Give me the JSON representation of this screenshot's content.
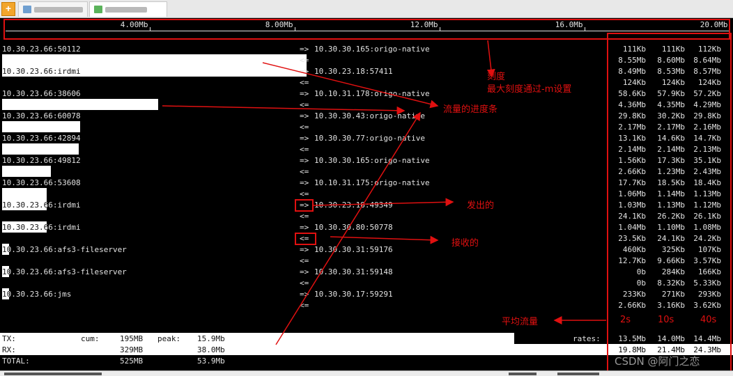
{
  "tabs": [
    {
      "label": "2.4.10.25.03",
      "active": false
    },
    {
      "label": "10.30.23.66",
      "active": true
    }
  ],
  "scale": {
    "ticks": [
      "4.00Mb",
      "8.00Mb",
      "12.0Mb",
      "16.0Mb",
      "20.0Mb"
    ],
    "max_mb": 20
  },
  "connections": [
    {
      "src": "10.30.23.66:50112",
      "dst": "10.30.30.165:origo-native",
      "tx": [
        "111Kb",
        "111Kb",
        "112Kb"
      ],
      "rx": [
        "8.55Mb",
        "8.60Mb",
        "8.64Mb"
      ],
      "tx_bar": 0,
      "rx_bar": 0.42
    },
    {
      "src": "10.30.23.66:irdmi",
      "dst": "10.30.23.18:57411",
      "tx": [
        "8.49Mb",
        "8.53Mb",
        "8.57Mb"
      ],
      "rx": [
        "124Kb",
        "124Kb",
        "124Kb"
      ],
      "tx_bar": 0.42,
      "rx_bar": 0
    },
    {
      "src": "10.30.23.66:38606",
      "dst": "10.10.31.178:origo-native",
      "tx": [
        "58.6Kb",
        "57.9Kb",
        "57.2Kb"
      ],
      "rx": [
        "4.36Mb",
        "4.35Mb",
        "4.29Mb"
      ],
      "tx_bar": 0,
      "rx_bar": 0.215
    },
    {
      "src": "10.30.23.66:60078",
      "dst": "10.30.30.43:origo-native",
      "tx": [
        "29.8Kb",
        "30.2Kb",
        "29.8Kb"
      ],
      "rx": [
        "2.17Mb",
        "2.17Mb",
        "2.16Mb"
      ],
      "tx_bar": 0,
      "rx_bar": 0.108
    },
    {
      "src": "10.30.23.66:42894",
      "dst": "10.30.30.77:origo-native",
      "tx": [
        "13.1Kb",
        "14.6Kb",
        "14.7Kb"
      ],
      "rx": [
        "2.14Mb",
        "2.14Mb",
        "2.13Mb"
      ],
      "tx_bar": 0,
      "rx_bar": 0.106
    },
    {
      "src": "10.30.23.66:49812",
      "dst": "10.30.30.165:origo-native",
      "tx": [
        "1.56Kb",
        "17.3Kb",
        "35.1Kb"
      ],
      "rx": [
        "2.66Kb",
        "1.23Mb",
        "2.43Mb"
      ],
      "tx_bar": 0,
      "rx_bar": 0.067
    },
    {
      "src": "10.30.23.66:53608",
      "dst": "10.10.31.175:origo-native",
      "tx": [
        "17.7Kb",
        "18.5Kb",
        "18.4Kb"
      ],
      "rx": [
        "1.06Mb",
        "1.14Mb",
        "1.13Mb"
      ],
      "tx_bar": 0,
      "rx_bar": 0.062
    },
    {
      "src": "10.30.23.66:irdmi",
      "dst": "10.30.23.18:49349",
      "tx": [
        "1.03Mb",
        "1.13Mb",
        "1.12Mb"
      ],
      "rx": [
        "24.1Kb",
        "26.2Kb",
        "26.1Kb"
      ],
      "tx_bar": 0.062,
      "rx_bar": 0
    },
    {
      "src": "10.30.23.66:irdmi",
      "dst": "10.30.30.80:50778",
      "tx": [
        "1.04Mb",
        "1.10Mb",
        "1.08Mb"
      ],
      "rx": [
        "23.5Kb",
        "24.1Kb",
        "24.2Kb"
      ],
      "tx_bar": 0.062,
      "rx_bar": 0
    },
    {
      "src": "10.30.23.66:afs3-fileserver",
      "dst": "10.30.30.31:59176",
      "tx": [
        "460Kb",
        "325Kb",
        "107Kb"
      ],
      "rx": [
        "12.7Kb",
        "9.66Kb",
        "3.57Kb"
      ],
      "tx_bar": 0.01,
      "rx_bar": 0
    },
    {
      "src": "10.30.23.66:afs3-fileserver",
      "dst": "10.30.30.31:59148",
      "tx": [
        "0b",
        "284Kb",
        "166Kb"
      ],
      "rx": [
        "0b",
        "8.32Kb",
        "5.33Kb"
      ],
      "tx_bar": 0.01,
      "rx_bar": 0
    },
    {
      "src": "10.30.23.66:jms",
      "dst": "10.30.30.17:59291",
      "tx": [
        "233Kb",
        "271Kb",
        "293Kb"
      ],
      "rx": [
        "2.66Kb",
        "3.16Kb",
        "3.62Kb"
      ],
      "tx_bar": 0.01,
      "rx_bar": 0
    }
  ],
  "arrows": {
    "out": "=>",
    "in": "<="
  },
  "summary": {
    "tx": {
      "label": "TX:",
      "cum_label": "cum:",
      "cum": "195MB",
      "peak_label": "peak:",
      "peak": "15.9Mb",
      "rates_label": "rates:",
      "rates": [
        "13.5Mb",
        "14.0Mb",
        "14.4Mb"
      ]
    },
    "rx": {
      "label": "RX:",
      "cum": "329MB",
      "peak": "38.0Mb",
      "rates": [
        "19.8Mb",
        "21.4Mb",
        "24.3Mb"
      ]
    },
    "total": {
      "label": "TOTAL:",
      "cum": "525MB",
      "peak": "53.9Mb"
    }
  },
  "annotations": {
    "scale_title": "刻度",
    "scale_note": "最大刻度通过-m设置",
    "progress_bar": "流量的进度条",
    "sent": "发出的",
    "received": "接收的",
    "average": "平均流量",
    "col_2s": "2s",
    "col_10s": "10s",
    "col_40s": "40s"
  },
  "watermark": "CSDN @阿门之恋",
  "colors": {
    "annotation": "#e01010",
    "terminal_bg": "#000000",
    "terminal_fg": "#e2e2e2"
  }
}
